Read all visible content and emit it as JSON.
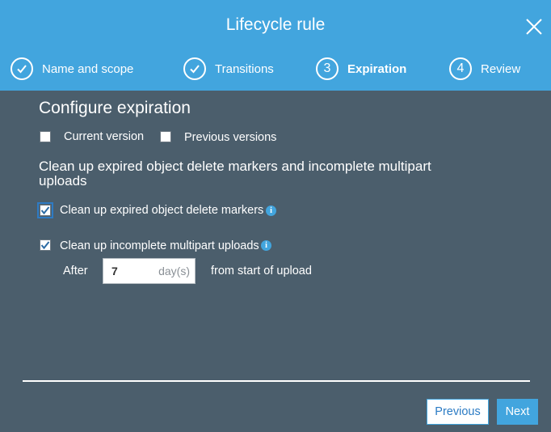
{
  "header": {
    "title": "Lifecycle rule",
    "steps": [
      {
        "number": "",
        "label": "Name and scope",
        "state": "done"
      },
      {
        "number": "",
        "label": "Transitions",
        "state": "done"
      },
      {
        "number": "3",
        "label": "Expiration",
        "state": "active"
      },
      {
        "number": "4",
        "label": "Review",
        "state": "pending"
      }
    ]
  },
  "expiration": {
    "heading": "Configure expiration",
    "current_version_label": "Current version",
    "current_version_checked": false,
    "previous_versions_label": "Previous versions",
    "previous_versions_checked": false
  },
  "cleanup": {
    "heading": "Clean up expired object delete markers and incomplete multipart uploads",
    "delete_markers_label": "Clean up expired object delete markers",
    "delete_markers_checked": true,
    "multipart_label": "Clean up incomplete multipart uploads",
    "multipart_checked": true,
    "after_label": "After",
    "days_value": "7",
    "days_unit": "day(s)",
    "from_start_label": "from start of upload"
  },
  "footer": {
    "previous_label": "Previous",
    "next_label": "Next"
  },
  "colors": {
    "header": "#42a5de",
    "body": "#4b5e6c",
    "accent": "#42a5de"
  }
}
